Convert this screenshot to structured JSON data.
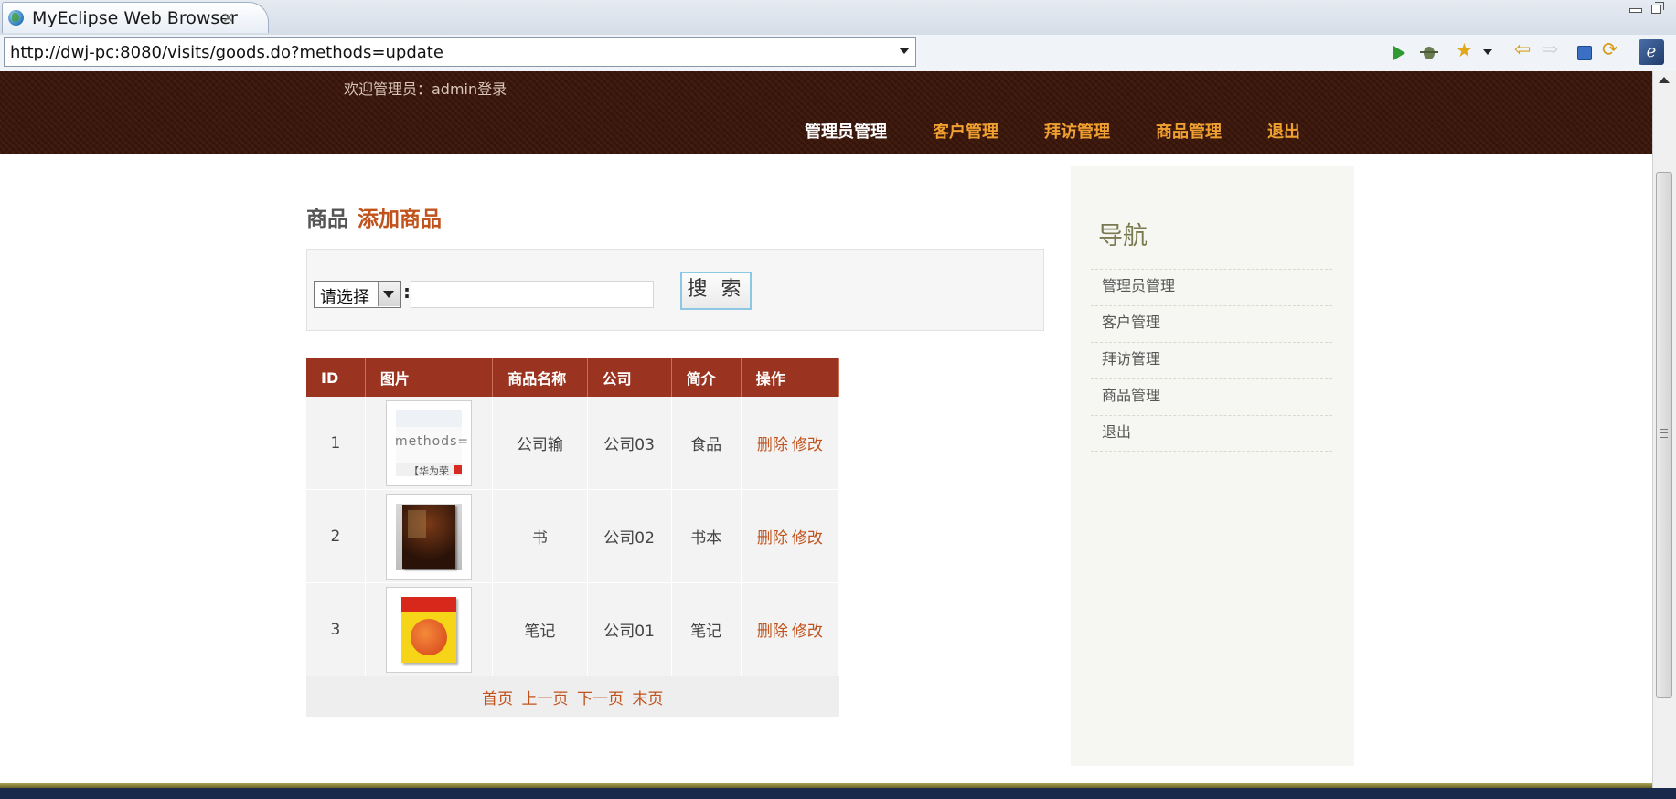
{
  "window": {
    "tab_title": "MyEclipse Web Browser",
    "url": "http://dwj-pc:8080/visits/goods.do?methods=update"
  },
  "header": {
    "welcome": "欢迎管理员：admin登录",
    "nav": [
      {
        "label": "管理员管理",
        "active": true
      },
      {
        "label": "客户管理",
        "active": false
      },
      {
        "label": "拜访管理",
        "active": false
      },
      {
        "label": "商品管理",
        "active": false
      },
      {
        "label": "退出",
        "active": false
      }
    ]
  },
  "main": {
    "heading": "商品",
    "add_link": "添加商品",
    "search": {
      "select_value": "请选择",
      "colon": ":",
      "input_value": "",
      "button_label": "搜 索"
    },
    "table": {
      "headers": [
        "ID",
        "图片",
        "商品名称",
        "公司",
        "简介",
        "操作"
      ],
      "rows": [
        {
          "id": "1",
          "name": "公司输",
          "company": "公司03",
          "desc": "食品",
          "thumb_text": "methods=",
          "thumb_sub": "【华为荣"
        },
        {
          "id": "2",
          "name": "书",
          "company": "公司02",
          "desc": "书本"
        },
        {
          "id": "3",
          "name": "笔记",
          "company": "公司01",
          "desc": "笔记"
        }
      ],
      "delete_label": "删除",
      "edit_label": "修改",
      "pager": {
        "first": "首页",
        "prev": "上一页",
        "next": "下一页",
        "last": "末页"
      }
    }
  },
  "sidebar": {
    "title": "导航",
    "items": [
      "管理员管理",
      "客户管理",
      "拜访管理",
      "商品管理",
      "退出"
    ]
  },
  "colors": {
    "header_bg": "#3b160a",
    "nav_link": "#f0a030",
    "accent": "#c0521c",
    "table_header": "#9a3420"
  }
}
